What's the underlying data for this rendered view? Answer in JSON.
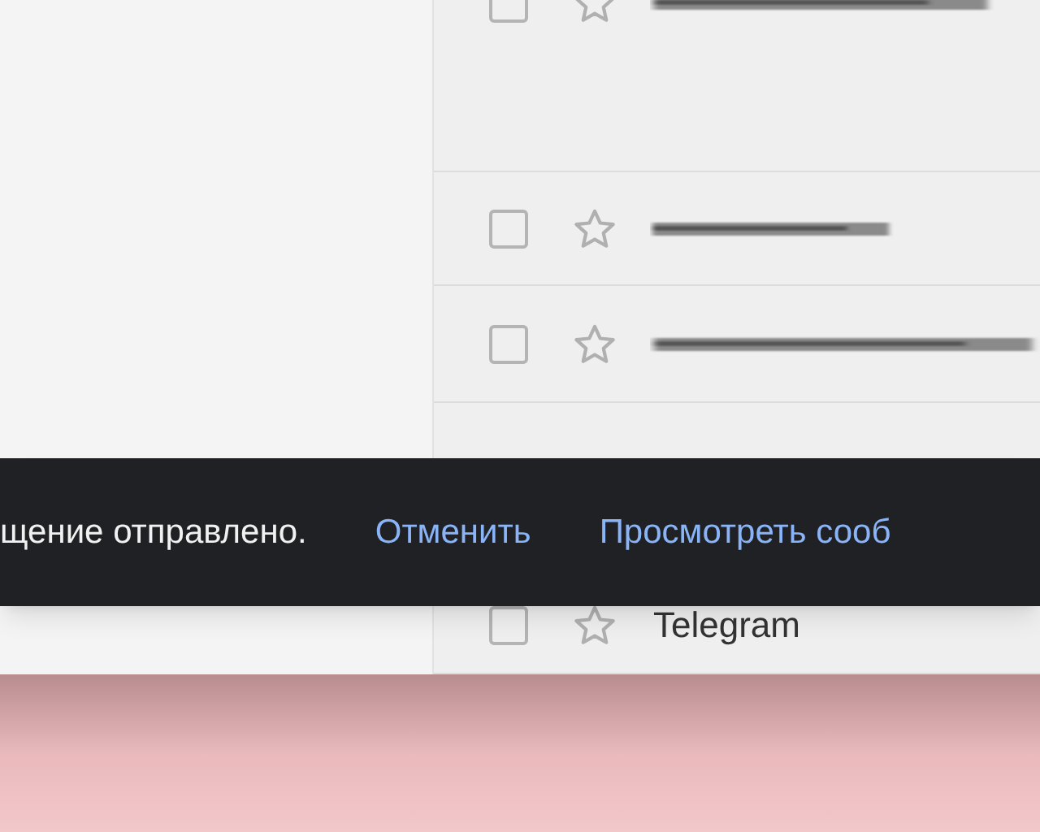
{
  "mail_list": {
    "rows": [
      {
        "checked": false,
        "starred": false,
        "kind": "blurred"
      },
      {
        "checked": false,
        "starred": false,
        "kind": "blurred"
      },
      {
        "checked": false,
        "starred": false,
        "kind": "blurred"
      },
      {
        "checked": false,
        "starred": false,
        "kind": "sender",
        "sender": "Telegram"
      }
    ]
  },
  "snackbar": {
    "message": "щение отправлено.",
    "actions": [
      "Отменить",
      "Просмотреть сооб"
    ]
  }
}
